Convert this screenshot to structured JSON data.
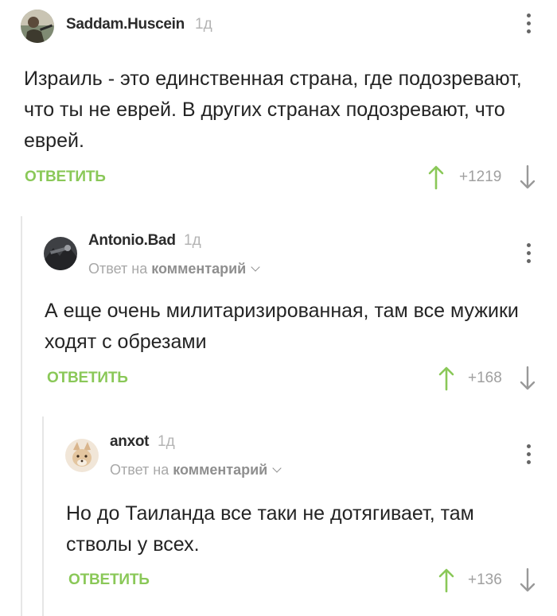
{
  "comments": [
    {
      "author": "Saddam.Huscein",
      "time": "1д",
      "text": "Израиль - это единственная страна, где подозревают, что ты не еврей. В других странах подозревают, что еврей.",
      "reply_label": "ОТВЕТИТЬ",
      "score": "+1219"
    },
    {
      "author": "Antonio.Bad",
      "time": "1д",
      "reply_to_prefix": "Ответ на",
      "reply_to_target": "комментарий",
      "text": "А еще очень милитаризированная, там все мужики ходят с обрезами",
      "reply_label": "ОТВЕТИТЬ",
      "score": "+168"
    },
    {
      "author": "anxot",
      "time": "1д",
      "reply_to_prefix": "Ответ на",
      "reply_to_target": "комментарий",
      "text": "Но до Таиланда все таки не дотягивает, там стволы у всех.",
      "reply_label": "ОТВЕТИТЬ",
      "score": "+136"
    }
  ],
  "colors": {
    "accent_green": "#8ac858",
    "muted_gray": "#a0a0a0",
    "thread_line": "#e6e6e6"
  },
  "icons": {
    "upvote": "arrow-up-icon",
    "downvote": "arrow-down-icon",
    "menu": "kebab-menu-icon"
  }
}
